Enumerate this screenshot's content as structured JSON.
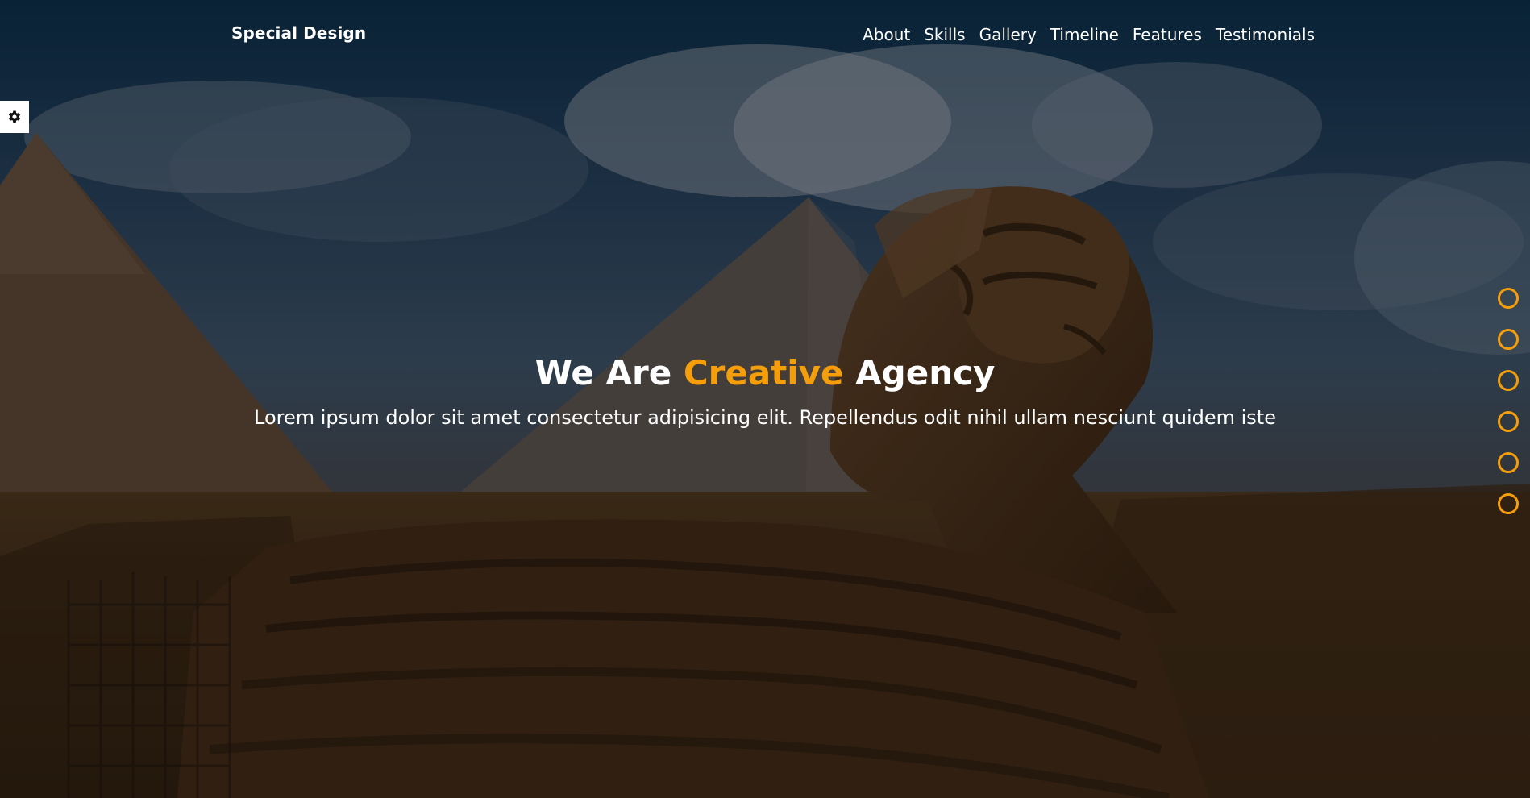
{
  "brand": {
    "name": "Special Design"
  },
  "nav": {
    "links": [
      "About",
      "Skills",
      "Gallery",
      "Timeline",
      "Features",
      "Testimonials"
    ]
  },
  "settings": {
    "icon": "gear-icon"
  },
  "hero": {
    "title_before": "We Are",
    "title_accent": "Creative",
    "title_after": "Agency",
    "subtitle": "Lorem ipsum dolor sit amet consectetur adipisicing elit. Repellendus odit nihil ullam nesciunt quidem iste"
  },
  "colors": {
    "accent": "#f59e0b",
    "text": "#ffffff",
    "settings_bg": "#ffffff"
  }
}
